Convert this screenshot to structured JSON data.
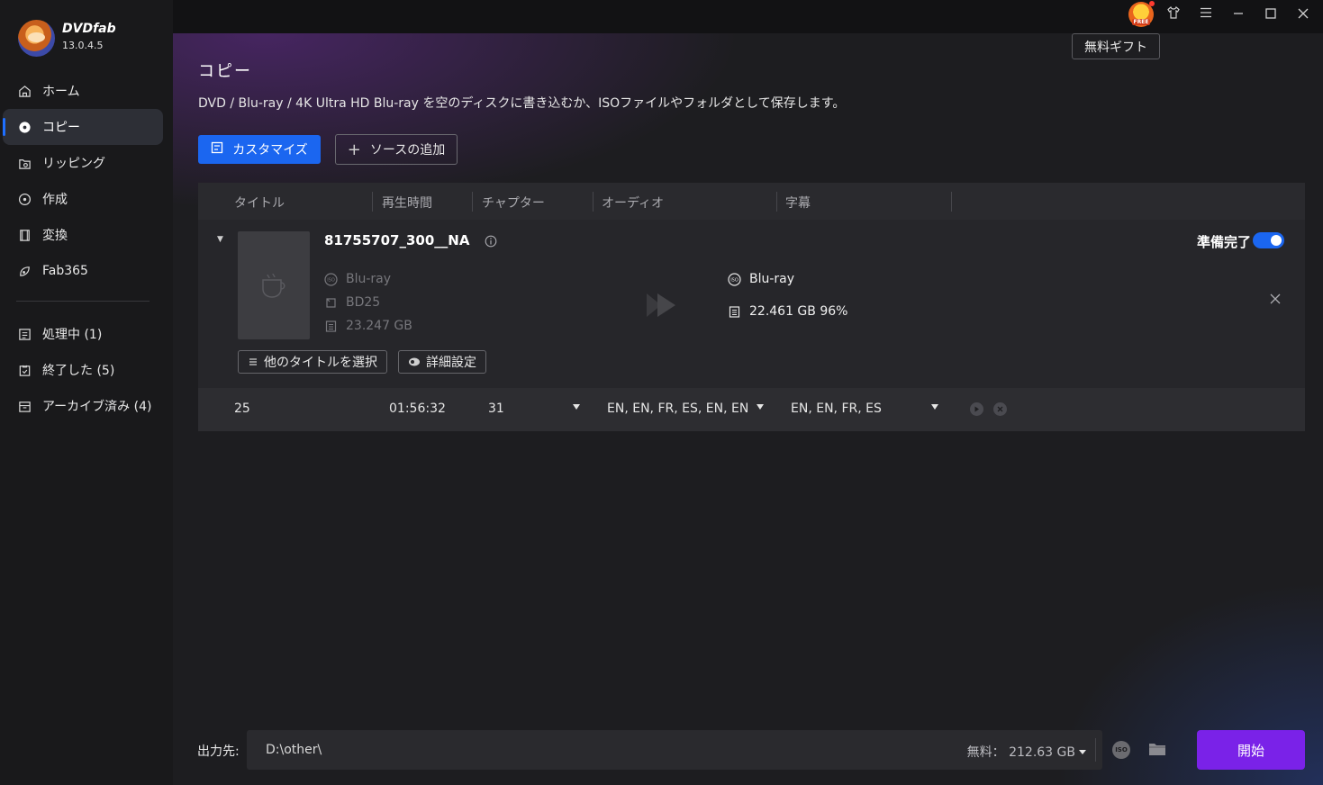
{
  "app": {
    "name": "DVDfab",
    "version": "13.0.4.5"
  },
  "sidebar": {
    "items": [
      {
        "label": "ホーム",
        "icon": "home-icon"
      },
      {
        "label": "コピー",
        "icon": "disc-icon",
        "active": true
      },
      {
        "label": "リッピング",
        "icon": "rip-icon"
      },
      {
        "label": "作成",
        "icon": "create-icon"
      },
      {
        "label": "変換",
        "icon": "film-icon"
      },
      {
        "label": "Fab365",
        "icon": "fab365-icon"
      }
    ],
    "tasks": [
      {
        "label": "処理中 (1)",
        "icon": "processing-icon"
      },
      {
        "label": "終了した (5)",
        "icon": "finished-icon"
      },
      {
        "label": "アーカイブ済み (4)",
        "icon": "archive-icon"
      }
    ]
  },
  "topbar": {
    "gift_badge": "FREE",
    "gift_tooltip": "無料ギフト"
  },
  "page": {
    "title": "コピー",
    "description": "DVD / Blu-ray / 4K Ultra HD Blu-ray を空のディスクに書き込むか、ISOファイルやフォルダとして保存します。",
    "customize_label": "カスタマイズ",
    "add_source_label": "ソースの追加"
  },
  "table": {
    "headers": [
      "タイトル",
      "再生時間",
      "チャプター",
      "オーディオ",
      "字幕"
    ],
    "item": {
      "name": "81755707_300__NA",
      "source": {
        "type": "Blu-ray",
        "disc": "BD25",
        "size": "23.247 GB"
      },
      "output": {
        "type": "Blu-ray",
        "size": "22.461 GB 96%"
      },
      "status": "準備完了",
      "enabled": true,
      "select_titles_label": "他のタイトルを選択",
      "advanced_label": "詳細設定"
    },
    "row": {
      "title": "25",
      "duration": "01:56:32",
      "chapters": "31",
      "audio": "EN, EN, FR, ES, EN, EN",
      "subtitles": "EN, EN, FR, ES"
    }
  },
  "footer": {
    "output_label": "出力先:",
    "output_path": "D:\\other\\",
    "free_space": "無料：  212.63 GB",
    "iso_label": "ISO",
    "start_label": "開始"
  },
  "colors": {
    "accent": "#1b66f0",
    "start": "#7a22e8",
    "sidebar_bg": "#19191b",
    "main_bg": "#1d1d20"
  }
}
